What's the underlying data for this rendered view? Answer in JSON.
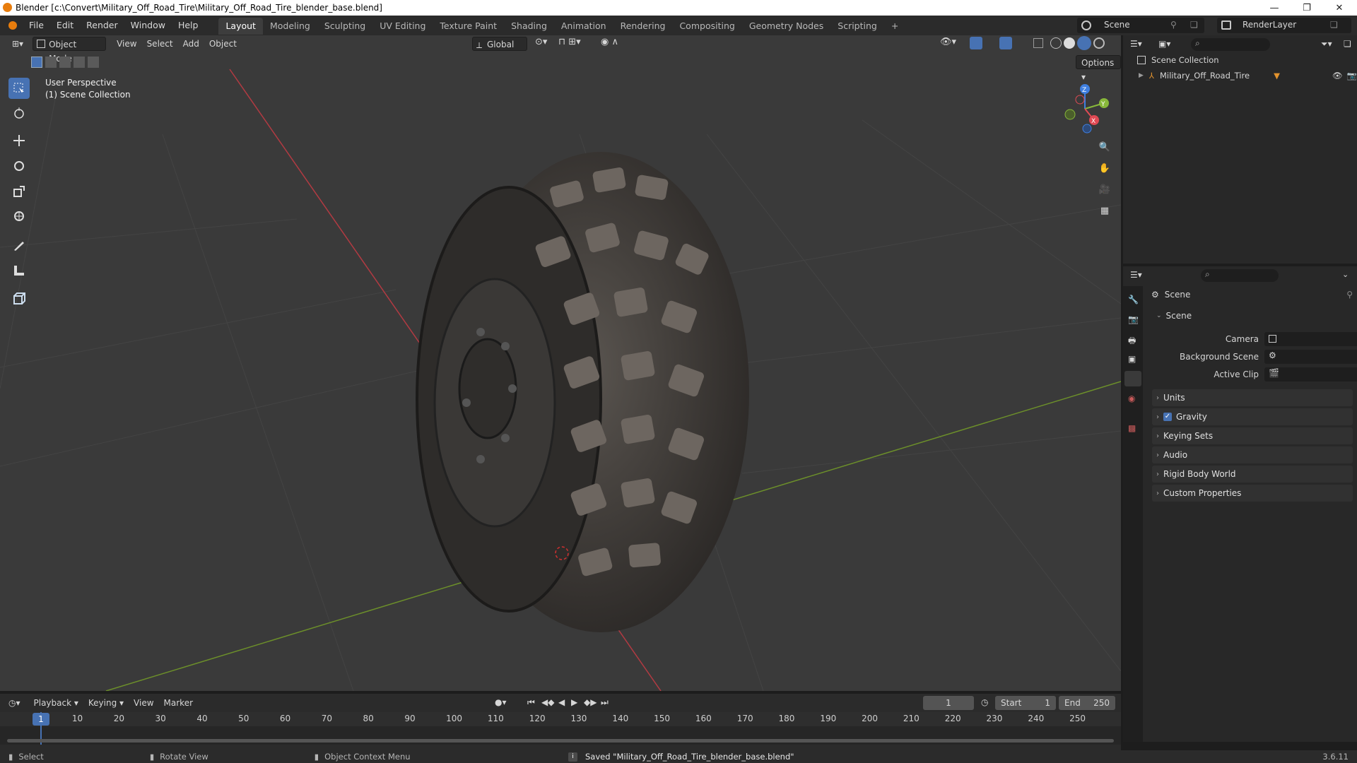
{
  "window": {
    "title": "Blender [c:\\Convert\\Military_Off_Road_Tire\\Military_Off_Road_Tire_blender_base.blend]",
    "controls": [
      "—",
      "❐",
      "✕"
    ]
  },
  "topbar": {
    "menus": [
      "File",
      "Edit",
      "Render",
      "Window",
      "Help"
    ],
    "workspaces": [
      "Layout",
      "Modeling",
      "Sculpting",
      "UV Editing",
      "Texture Paint",
      "Shading",
      "Animation",
      "Rendering",
      "Compositing",
      "Geometry Nodes",
      "Scripting"
    ],
    "active_workspace": "Layout",
    "add_tab": "+",
    "scene_name": "Scene",
    "view_layer": "RenderLayer"
  },
  "viewport": {
    "mode": "Object Mode",
    "menus": [
      "View",
      "Select",
      "Add",
      "Object"
    ],
    "orientation": "Global",
    "options_label": "Options",
    "overlay_line1": "User Perspective",
    "overlay_line2": "(1) Scene Collection",
    "gizmo_axes": [
      "Z",
      "Y",
      "X"
    ]
  },
  "outliner": {
    "root": "Scene Collection",
    "items": [
      {
        "label": "Military_Off_Road_Tire"
      }
    ]
  },
  "properties": {
    "header": "Scene",
    "section": "Scene",
    "fields": [
      {
        "label": "Camera"
      },
      {
        "label": "Background Scene"
      },
      {
        "label": "Active Clip"
      }
    ],
    "panels": [
      "Units",
      "Gravity",
      "Keying Sets",
      "Audio",
      "Rigid Body World",
      "Custom Properties"
    ],
    "gravity_checked": true
  },
  "timeline": {
    "menus": [
      "Playback",
      "Keying",
      "View",
      "Marker"
    ],
    "current_frame": "1",
    "start_label": "Start",
    "start": "1",
    "end_label": "End",
    "end": "250",
    "ruler": [
      "1",
      "10",
      "20",
      "30",
      "40",
      "50",
      "60",
      "70",
      "80",
      "90",
      "100",
      "110",
      "120",
      "130",
      "140",
      "150",
      "160",
      "170",
      "180",
      "190",
      "200",
      "210",
      "220",
      "230",
      "240",
      "250"
    ]
  },
  "statusbar": {
    "select": "Select",
    "rotate": "Rotate View",
    "context": "Object Context Menu",
    "message": "Saved \"Military_Off_Road_Tire_blender_base.blend\"",
    "version": "3.6.11"
  },
  "colors": {
    "accent": "#4772b3",
    "x_axis": "#e04a54",
    "y_axis": "#88b83a",
    "z_axis": "#3f7fe0",
    "outliner_mesh_icon": "#e2932e"
  }
}
